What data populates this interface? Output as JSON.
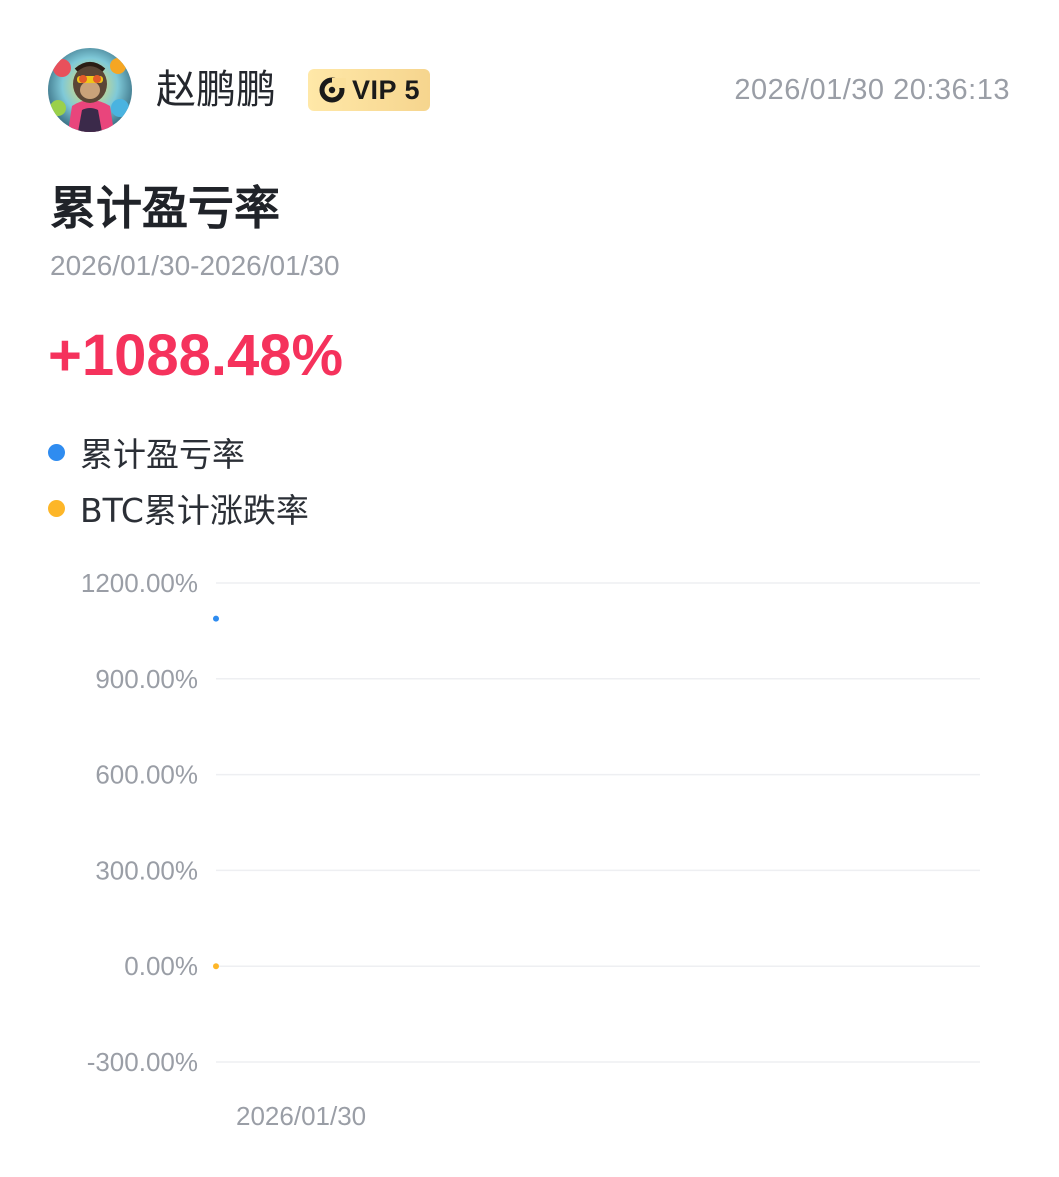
{
  "header": {
    "username": "赵鹏鹏",
    "vip_label": "VIP 5",
    "timestamp": "2026/01/30 20:36:13",
    "avatar_icon": "avatar-image",
    "vip_icon": "vip-ring-icon"
  },
  "title": "累计盈亏率",
  "date_range": "2026/01/30-2026/01/30",
  "main_value": "+1088.48%",
  "legend": [
    {
      "label": "累计盈亏率",
      "color": "#2f8cf0"
    },
    {
      "label": "BTC累计涨跌率",
      "color": "#fdb628"
    }
  ],
  "chart_data": {
    "type": "line",
    "x": [
      "2026/01/30"
    ],
    "x_tick_labels": [
      "2026/01/30"
    ],
    "y_tick_labels": [
      "1200.00%",
      "900.00%",
      "600.00%",
      "300.00%",
      "0.00%",
      "-300.00%"
    ],
    "y_ticks": [
      1200,
      900,
      600,
      300,
      0,
      -300
    ],
    "ylim": [
      -300,
      1200
    ],
    "grid": true,
    "legend_placement": "top-left",
    "series": [
      {
        "name": "累计盈亏率",
        "color": "#2f8cf0",
        "values": [
          1088.48
        ]
      },
      {
        "name": "BTC累计涨跌率",
        "color": "#fdb628",
        "values": [
          0
        ]
      }
    ]
  }
}
